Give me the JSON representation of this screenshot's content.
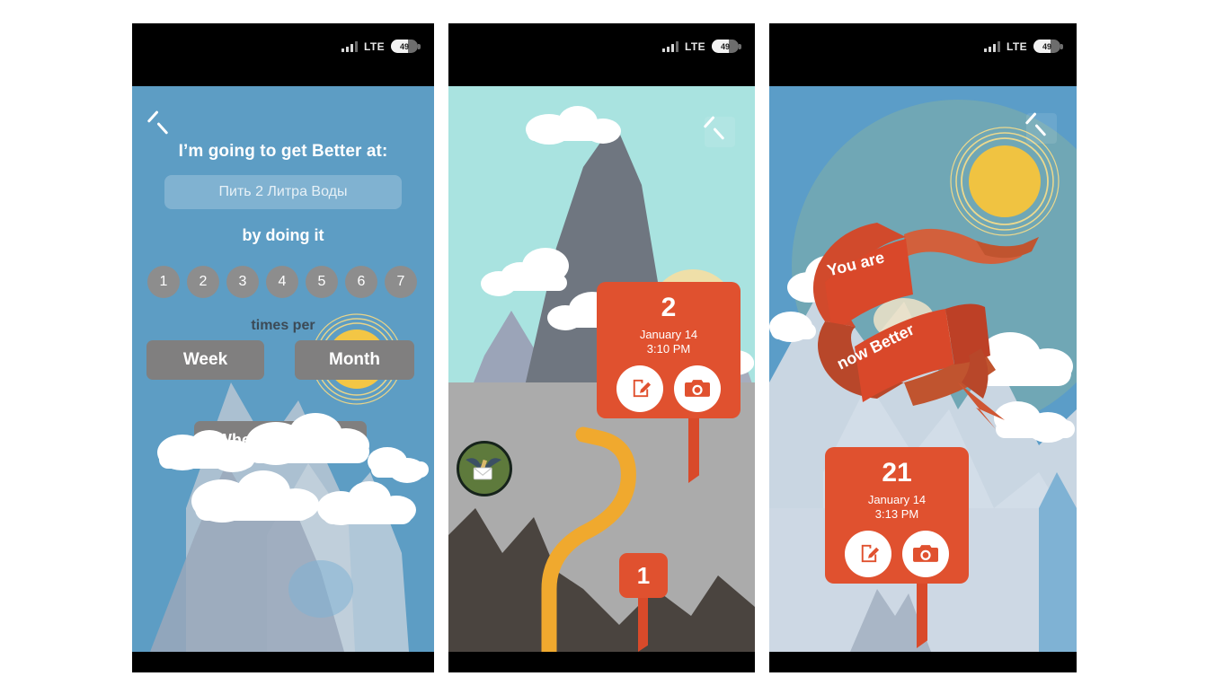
{
  "app": {
    "accent_red": "#E0512F",
    "sky_blue": "#5D9DC4",
    "teal_sky": "#A9E3E0",
    "path_yellow": "#F0A92E",
    "pill_grey": "#807F7F",
    "sun_yellow": "#F0C341"
  },
  "statusbar": {
    "network": "LTE",
    "battery": "49",
    "signal_icon": "signal-bars-icon",
    "battery_icon": "battery-icon"
  },
  "screen1": {
    "back_icon": "back-chevron-icon",
    "title": "I’m going to get Better at:",
    "goal_value": "Пить 2 Литра Воды",
    "goal_placeholder": "Пить 2 Литра Воды",
    "subtitle": "by doing it",
    "frequency_numbers": [
      "1",
      "2",
      "3",
      "4",
      "5",
      "6",
      "7"
    ],
    "times_per_label": "times per",
    "period_options": [
      "Week",
      "Month"
    ],
    "whenever_label": "Whenever I want",
    "sun_icon": "sun-icon"
  },
  "screen2": {
    "back_icon": "back-chevron-icon",
    "markers": [
      {
        "count": "2",
        "date": "January 14",
        "time": "3:10 PM",
        "note_icon": "note-edit-icon",
        "camera_icon": "camera-icon"
      },
      {
        "count": "1"
      }
    ],
    "badge_icon": "bird-mail-badge-icon",
    "path_icon": "trail-path-icon",
    "mountain_icon": "mountain-icon"
  },
  "screen3": {
    "back_icon": "back-chevron-icon",
    "ribbon_line1": "You are",
    "ribbon_line2": "now Better",
    "marker": {
      "count": "21",
      "date": "January 14",
      "time": "3:13 PM",
      "note_icon": "note-edit-icon",
      "camera_icon": "camera-icon"
    },
    "sun_icon": "sun-icon",
    "cloud_icon": "cloud-icon"
  }
}
